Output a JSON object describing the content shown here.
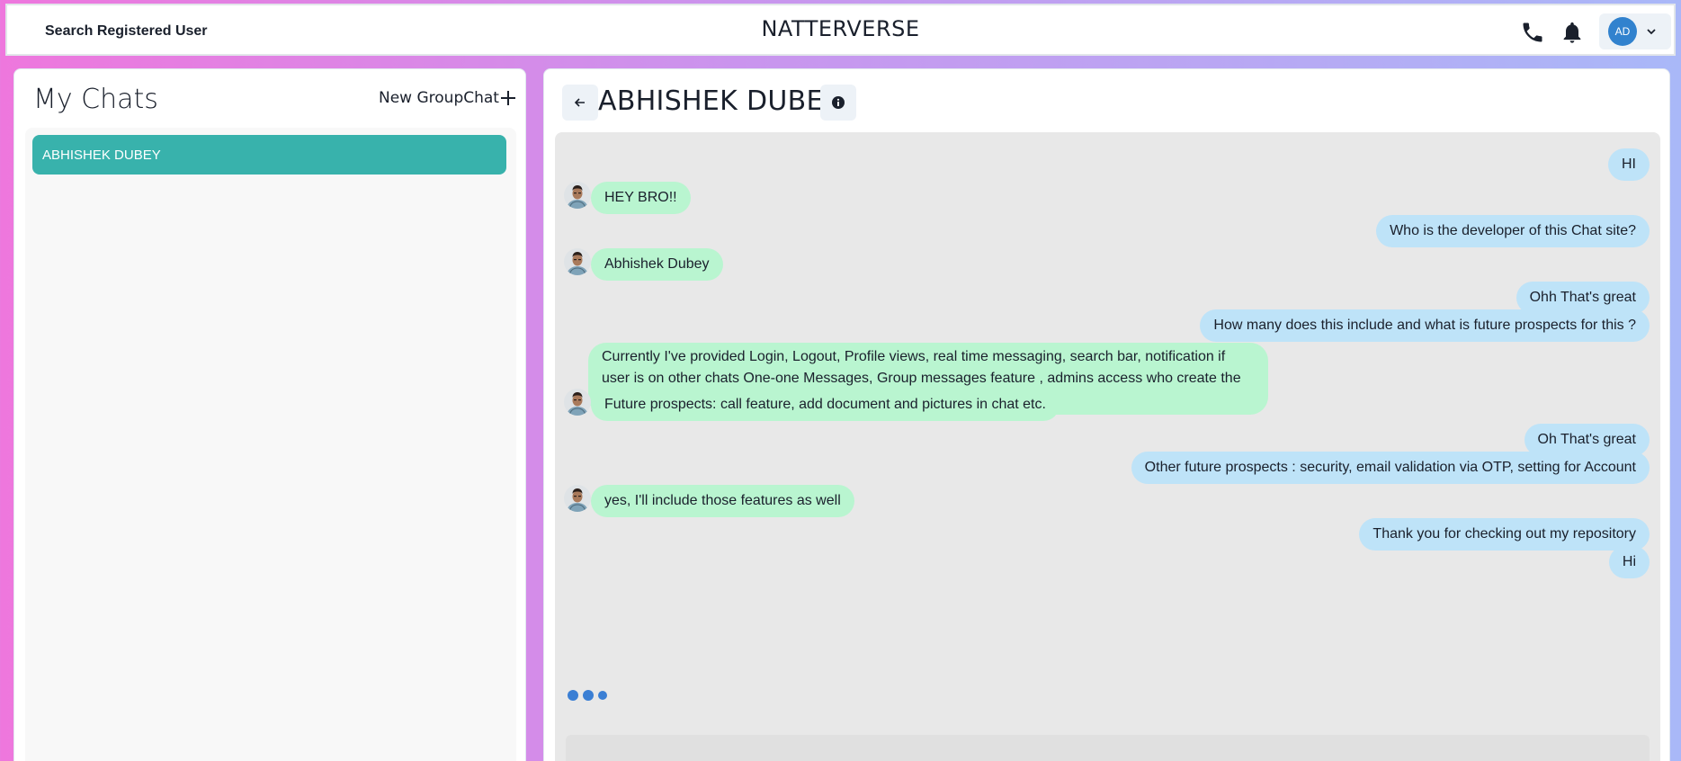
{
  "header": {
    "search_label": "Search Registered User",
    "brand": "NATTERVERSE",
    "user_initials": "AD",
    "icons": [
      "phone-icon",
      "bell-icon",
      "chevron-down-icon"
    ]
  },
  "sidebar": {
    "title": "My Chats",
    "new_group_label": "New GroupChat",
    "chats": [
      {
        "name": "ABHISHEK DUBEY",
        "selected": true
      }
    ]
  },
  "chat": {
    "title": "ABHISHEK DUBEY",
    "messages": [
      {
        "from": "me",
        "text": "HI"
      },
      {
        "from": "them",
        "text": "HEY BRO!!"
      },
      {
        "from": "me",
        "text": "Who is the developer of this Chat site?"
      },
      {
        "from": "them",
        "text": "Abhishek Dubey"
      },
      {
        "from": "me",
        "text": "Ohh That's great"
      },
      {
        "from": "me",
        "text": "How many does this include and what is future prospects for this ?"
      },
      {
        "from": "them",
        "text": "Currently I've provided Login, Logout, Profile views, real time messaging, search bar, notification if user is on other chats One-one Messages, Group messages feature , admins access who create the group."
      },
      {
        "from": "them",
        "text": "Future prospects: call feature, add document and pictures in chat etc."
      },
      {
        "from": "me",
        "text": "Oh That's great"
      },
      {
        "from": "me",
        "text": "Other future prospects : security, email validation via OTP, setting for Account"
      },
      {
        "from": "them",
        "text": "yes, I'll include those features as well"
      },
      {
        "from": "me",
        "text": "Thank you for checking out my repository"
      },
      {
        "from": "me",
        "text": "Hi"
      }
    ],
    "typing_indicator": true
  },
  "colors": {
    "selected_chat": "#38b2ac",
    "my_bubble": "#bee3f8",
    "their_bubble": "#b9f5d0",
    "avatar_bg": "#3182ce"
  }
}
